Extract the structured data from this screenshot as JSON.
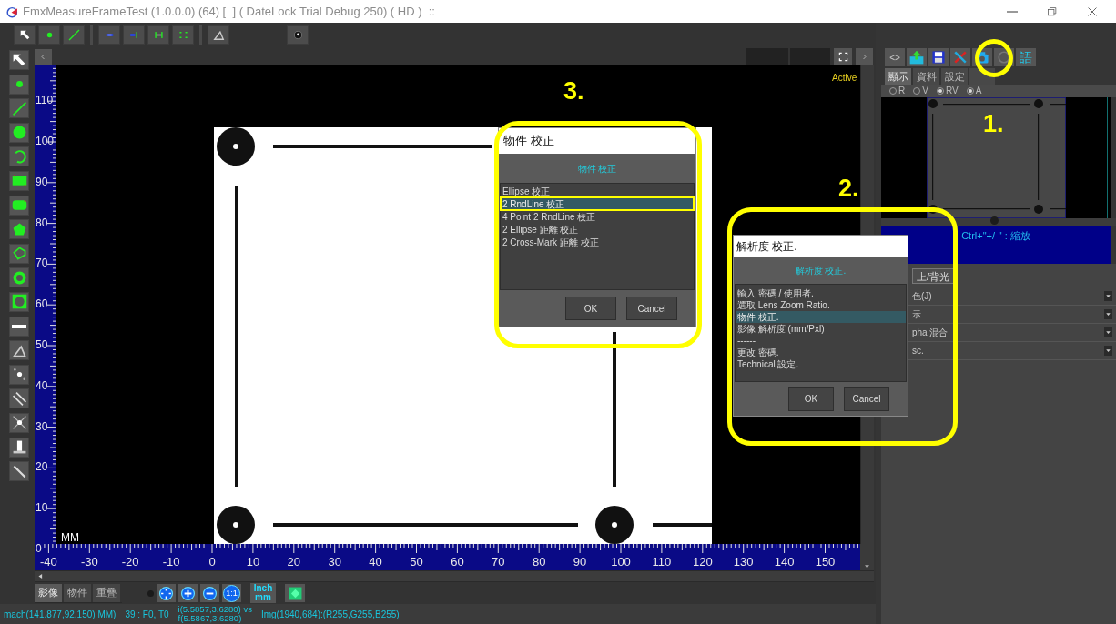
{
  "window": {
    "title": "FmxMeasureFrameTest (1.0.0.0) (64) [  ] ( DateLock Trial Debug 250) ( HD )  ::"
  },
  "canvas": {
    "status": "Active",
    "unit": "MM",
    "vruler": [
      "110",
      "100",
      "90",
      "80",
      "70",
      "60",
      "50",
      "40",
      "30",
      "20",
      "10",
      "0"
    ],
    "hruler": [
      "-40",
      "-30",
      "-20",
      "-10",
      "0",
      "10",
      "20",
      "30",
      "40",
      "50",
      "60",
      "70",
      "80",
      "90",
      "100",
      "110",
      "120",
      "130",
      "140",
      "150"
    ]
  },
  "panel": {
    "code_button": "<>",
    "language_button": "語",
    "tabs": [
      {
        "label": "顯示",
        "selected": true
      },
      {
        "label": "資料",
        "selected": false
      },
      {
        "label": "設定",
        "selected": false
      }
    ],
    "radios": [
      {
        "label": "R",
        "selected": false
      },
      {
        "label": "V",
        "selected": false
      },
      {
        "label": "RV",
        "selected": true
      },
      {
        "label": "A",
        "selected": true
      }
    ],
    "hint": "Ctrl+\"+/-\" : 縮放",
    "light_button": "上/背光",
    "rows": [
      "色(J)",
      "示",
      "pha 混合",
      "sc."
    ]
  },
  "bottom_tabs": [
    {
      "label": "影像",
      "selected": true
    },
    {
      "label": "物件",
      "selected": false
    },
    {
      "label": "重疊",
      "selected": false
    }
  ],
  "zoom_actual": "1:1",
  "unit_button": [
    "Inch",
    "mm"
  ],
  "status_bar": {
    "machine": "mach(141.877,92.150) MM)",
    "frame": "39 : F0, T0",
    "coords": [
      "i(5.5857,3.6280) vs",
      "f(5.5867,3.6280)"
    ],
    "pixel": "Img(1940,684):(R255,G255,B255)"
  },
  "dialogs": [
    {
      "title": "物件 校正",
      "header": "物件 校正",
      "items": [
        {
          "label": "Ellipse 校正",
          "selected": false
        },
        {
          "label": "2 RndLine 校正",
          "selected": true
        },
        {
          "label": "4 Point 2 RndLine 校正",
          "selected": false
        },
        {
          "label": "2 Ellipse 距離 校正",
          "selected": false
        },
        {
          "label": "2 Cross-Mark 距離 校正",
          "selected": false
        }
      ],
      "buttons": [
        "OK",
        "Cancel"
      ]
    },
    {
      "title": "解析度 校正.",
      "header": "解析度 校正.",
      "items": [
        {
          "label": "輸入 密碼 / 使用者.",
          "selected": false
        },
        {
          "label": "選取 Lens Zoom Ratio.",
          "selected": false
        },
        {
          "label": "物件 校正.",
          "selected": true
        },
        {
          "label": "影像 解析度 (mm/Pxl)",
          "selected": false
        },
        {
          "label": "------",
          "selected": false
        },
        {
          "label": "更改 密碼.",
          "selected": false
        },
        {
          "label": "Technical 設定.",
          "selected": false
        }
      ],
      "buttons": [
        "OK",
        "Cancel"
      ]
    }
  ],
  "annotations": [
    "1.",
    "2.",
    "3."
  ]
}
